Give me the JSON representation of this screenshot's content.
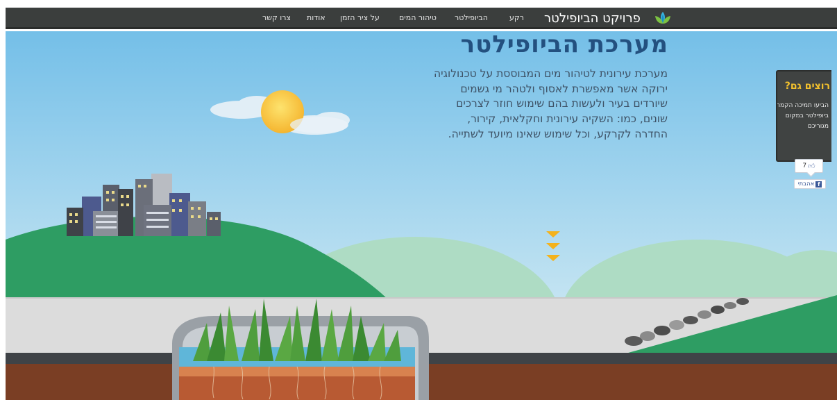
{
  "header": {
    "brand": "פרויקט הביופילטר",
    "nav": [
      {
        "label": "רקע"
      },
      {
        "label": "הביופילטר"
      },
      {
        "label": "טיהור המים"
      },
      {
        "label": "על ציר הזמן"
      },
      {
        "label": "אודות"
      },
      {
        "label": "צרו קשר"
      }
    ]
  },
  "hero": {
    "title": "מערכת הביופילטר",
    "description": "מערכת עירונית לטיהור מים המבוססת על טכנולוגיה ירוקה אשר מאפשרת לאסוף ולטהר מי גשמים שיורדים בעיר ולעשות בהם שימוש חוזר לצרכים שונים, כמו: השקיה עירונית וחקלאית, קירור, החדרה לקרקע, וכל שימוש שאינו מיועד לשתייה."
  },
  "promo": {
    "title": "רוצים גם?",
    "text": "הביעו תמיכה הקמת ביופילטר במקום מגוריכם"
  },
  "social": {
    "like_count": "7",
    "like_label": "אהבתי",
    "fb_letter": "f"
  },
  "icons": [
    "lotus-icon",
    "sun-icon",
    "scroll-down-icon",
    "thumbs-up-icon",
    "facebook-icon"
  ],
  "colors": {
    "nav_bg": "#3b3e3d",
    "sky": "#9fd0ec",
    "title": "#23507f",
    "hill": "#2e9d63",
    "promo_title": "#f3c12d",
    "arrows": "#f4b21c"
  }
}
